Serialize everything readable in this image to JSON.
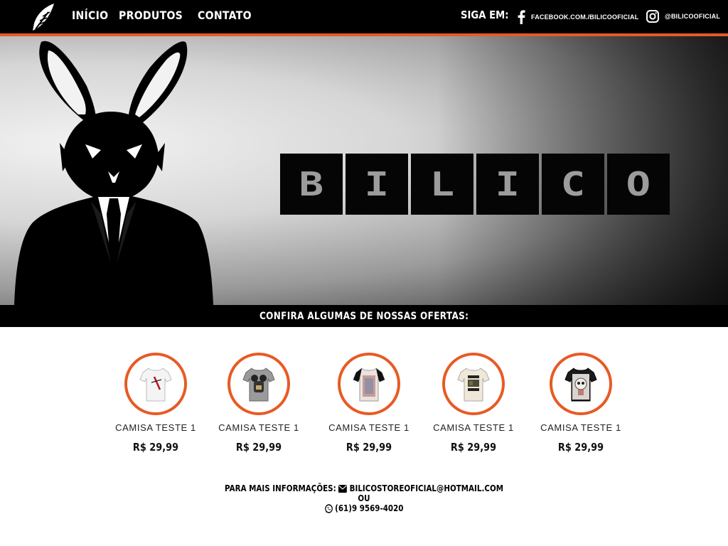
{
  "nav": {
    "items": [
      "INÍCIO",
      "PRODUTOS",
      "CONTATO"
    ]
  },
  "header": {
    "follow_label": "SIGA EM:",
    "facebook": "FACEBOOK.COM./BILICOOFICIAL",
    "instagram": "@BILICOOFICIAL"
  },
  "hero": {
    "brand_letters": [
      "B",
      "I",
      "L",
      "I",
      "C",
      "O"
    ]
  },
  "offers": {
    "title": "CONFIRA ALGUMAS DE NOSSAS OFERTAS:"
  },
  "products": [
    {
      "name": "CAMISA TESTE 1",
      "price": "R$ 29,99"
    },
    {
      "name": "CAMISA TESTE 1",
      "price": "R$ 29,99"
    },
    {
      "name": "CAMISA TESTE 1",
      "price": "R$ 29,99"
    },
    {
      "name": "CAMISA TESTE 1",
      "price": "R$ 29,99"
    },
    {
      "name": "CAMISA TESTE 1",
      "price": "R$ 29,99"
    }
  ],
  "contact": {
    "label": "PARA MAIS INFORMAÇÕES:",
    "email": "BILICOSTOREOFICIAL@HOTMAIL.COM",
    "or": "OU",
    "phone": "(61)9 9569-4020"
  },
  "colors": {
    "accent": "#e85a24",
    "bar": "#000000"
  }
}
